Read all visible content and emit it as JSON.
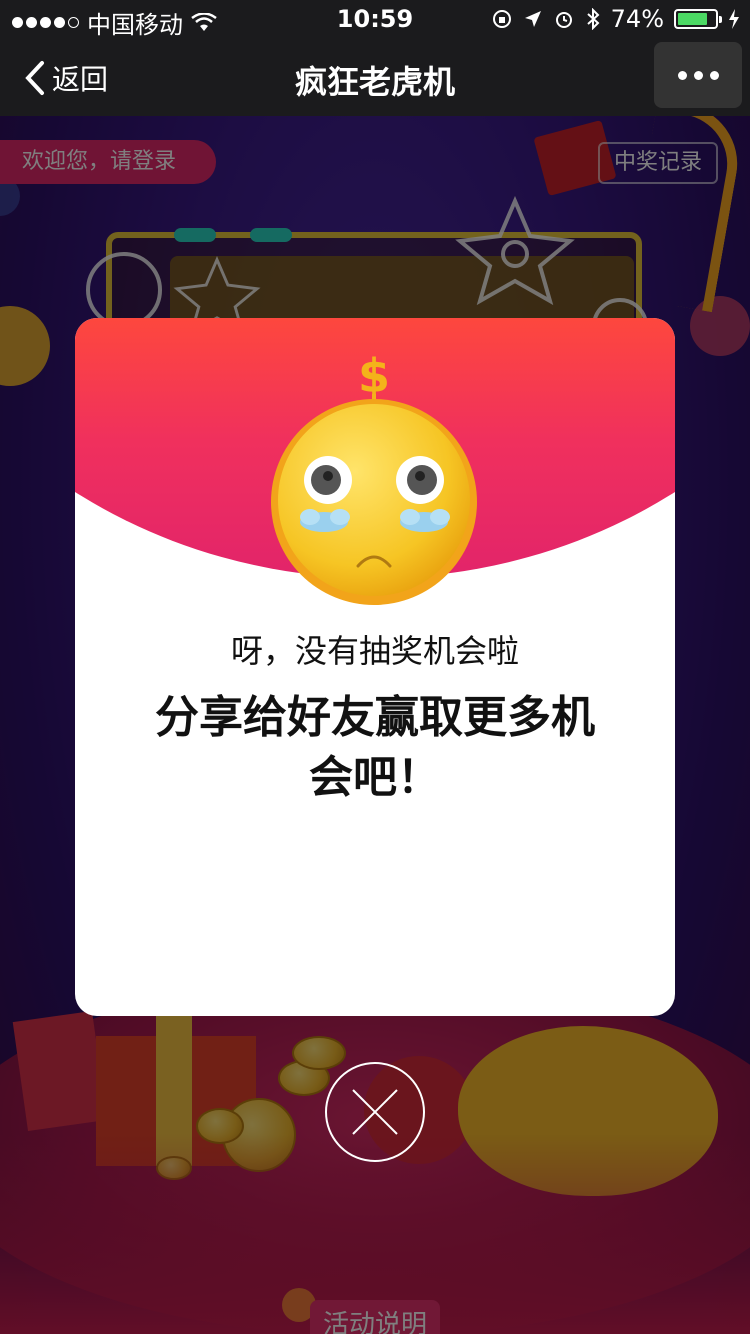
{
  "status_bar": {
    "carrier": "中国移动",
    "time": "10:59",
    "battery": "74%",
    "battery_level": 0.74
  },
  "nav": {
    "back_label": "返回",
    "title": "疯狂老虎机"
  },
  "background": {
    "login_text": "欢迎您，请登录",
    "record_text": "中奖记录",
    "bottom_button": "活动说明"
  },
  "modal": {
    "sub_message": "呀，没有抽奖机会啦",
    "main_message": "分享给好友赢取更多机会吧！"
  },
  "icons": {
    "emoji": "crying-face-icon",
    "close": "close-icon",
    "back": "chevron-left-icon",
    "more": "more-icon"
  },
  "colors": {
    "accent": "#ff5a2a",
    "pink": "#e2306c",
    "coin": "#f0b72e"
  }
}
